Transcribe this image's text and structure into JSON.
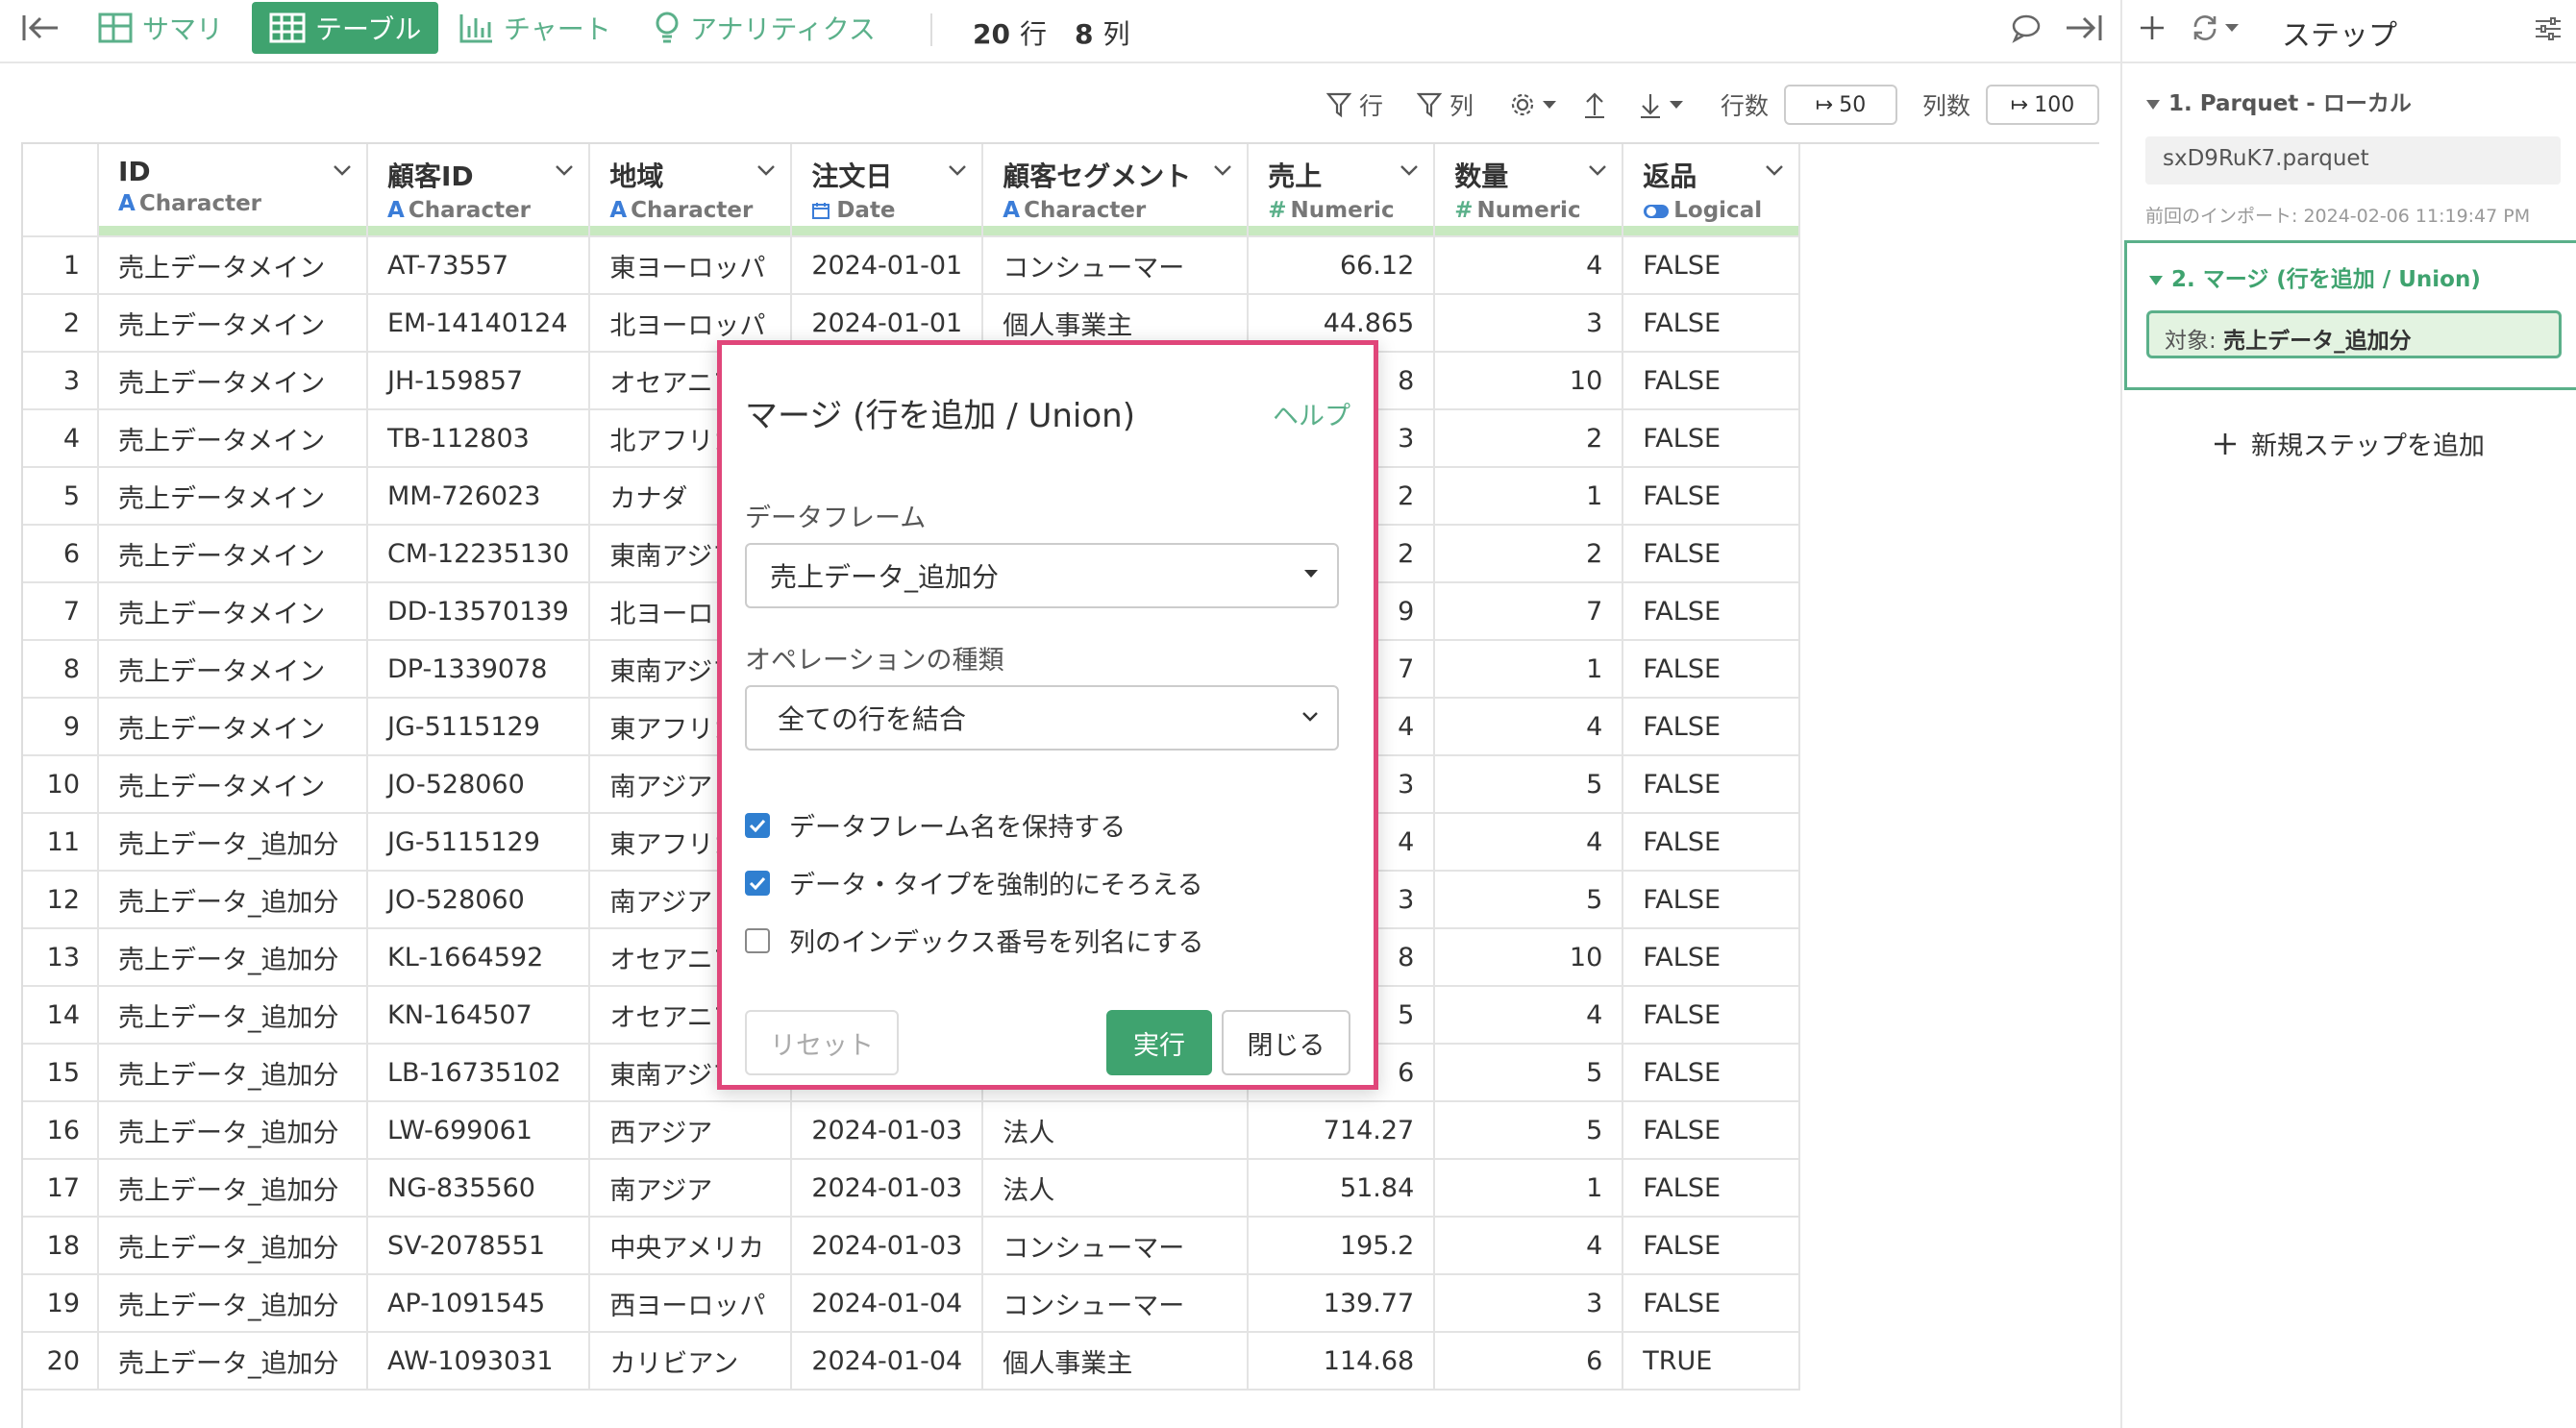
{
  "toolbar": {
    "tabs": [
      {
        "label": "サマリ",
        "icon": "summary-icon"
      },
      {
        "label": "テーブル",
        "icon": "table-icon",
        "active": true
      },
      {
        "label": "チャート",
        "icon": "chart-icon"
      },
      {
        "label": "アナリティクス",
        "icon": "bulb-icon"
      }
    ],
    "row_count": "20",
    "row_unit": "行",
    "col_count": "8",
    "col_unit": "列",
    "accent_color": "#3fa36f"
  },
  "subbar": {
    "filter_row": "行",
    "filter_col": "列",
    "rows_label": "行数",
    "rows_value": "50",
    "cols_label": "列数",
    "cols_value": "100"
  },
  "table": {
    "columns": [
      {
        "name": "ID",
        "type": "Character",
        "type_icon": "A"
      },
      {
        "name": "顧客ID",
        "type": "Character",
        "type_icon": "A"
      },
      {
        "name": "地域",
        "type": "Character",
        "type_icon": "A"
      },
      {
        "name": "注文日",
        "type": "Date",
        "type_icon": "calendar"
      },
      {
        "name": "顧客セグメント",
        "type": "Character",
        "type_icon": "A"
      },
      {
        "name": "売上",
        "type": "Numeric",
        "type_icon": "#"
      },
      {
        "name": "数量",
        "type": "Numeric",
        "type_icon": "#"
      },
      {
        "name": "返品",
        "type": "Logical",
        "type_icon": "toggle"
      }
    ],
    "rows": [
      [
        "1",
        "売上データメイン",
        "AT-73557",
        "東ヨーロッパ",
        "2024-01-01",
        "コンシューマー",
        "66.12",
        "4",
        "FALSE"
      ],
      [
        "2",
        "売上データメイン",
        "EM-14140124",
        "北ヨーロッパ",
        "2024-01-01",
        "個人事業主",
        "44.865",
        "3",
        "FALSE"
      ],
      [
        "3",
        "売上データメイン",
        "JH-159857",
        "オセアニア",
        "",
        "",
        "8",
        "10",
        "FALSE"
      ],
      [
        "4",
        "売上データメイン",
        "TB-112803",
        "北アフリカ",
        "",
        "",
        "3",
        "2",
        "FALSE"
      ],
      [
        "5",
        "売上データメイン",
        "MM-726023",
        "カナダ",
        "",
        "",
        "2",
        "1",
        "FALSE"
      ],
      [
        "6",
        "売上データメイン",
        "CM-12235130",
        "東南アジア",
        "",
        "",
        "2",
        "2",
        "FALSE"
      ],
      [
        "7",
        "売上データメイン",
        "DD-13570139",
        "北ヨーロッパ",
        "",
        "",
        "9",
        "7",
        "FALSE"
      ],
      [
        "8",
        "売上データメイン",
        "DP-1339078",
        "東南アジア",
        "",
        "",
        "7",
        "1",
        "FALSE"
      ],
      [
        "9",
        "売上データメイン",
        "JG-5115129",
        "東アフリカ",
        "",
        "",
        "4",
        "4",
        "FALSE"
      ],
      [
        "10",
        "売上データメイン",
        "JO-528060",
        "南アジア",
        "",
        "",
        "3",
        "5",
        "FALSE"
      ],
      [
        "11",
        "売上データ_追加分",
        "JG-5115129",
        "東アフリカ",
        "",
        "",
        "4",
        "4",
        "FALSE"
      ],
      [
        "12",
        "売上データ_追加分",
        "JO-528060",
        "南アジア",
        "",
        "",
        "3",
        "5",
        "FALSE"
      ],
      [
        "13",
        "売上データ_追加分",
        "KL-1664592",
        "オセアニア",
        "",
        "",
        "8",
        "10",
        "FALSE"
      ],
      [
        "14",
        "売上データ_追加分",
        "KN-164507",
        "オセアニア",
        "",
        "",
        "5",
        "4",
        "FALSE"
      ],
      [
        "15",
        "売上データ_追加分",
        "LB-16735102",
        "東南アジア",
        "",
        "",
        "6",
        "5",
        "FALSE"
      ],
      [
        "16",
        "売上データ_追加分",
        "LW-699061",
        "西アジア",
        "2024-01-03",
        "法人",
        "714.27",
        "5",
        "FALSE"
      ],
      [
        "17",
        "売上データ_追加分",
        "NG-835560",
        "南アジア",
        "2024-01-03",
        "法人",
        "51.84",
        "1",
        "FALSE"
      ],
      [
        "18",
        "売上データ_追加分",
        "SV-2078551",
        "中央アメリカ",
        "2024-01-03",
        "コンシューマー",
        "195.2",
        "4",
        "FALSE"
      ],
      [
        "19",
        "売上データ_追加分",
        "AP-1091545",
        "西ヨーロッパ",
        "2024-01-04",
        "コンシューマー",
        "139.77",
        "3",
        "FALSE"
      ],
      [
        "20",
        "売上データ_追加分",
        "AW-1093031",
        "カリビアン",
        "2024-01-04",
        "個人事業主",
        "114.68",
        "6",
        "TRUE"
      ]
    ]
  },
  "dialog": {
    "title": "マージ (行を追加 / Union)",
    "help": "ヘルプ",
    "dataframe_label": "データフレーム",
    "dataframe_value": "売上データ_追加分",
    "operation_label": "オペレーションの種類",
    "operation_value": "全ての行を結合",
    "checks": [
      {
        "label": "データフレーム名を保持する",
        "checked": true
      },
      {
        "label": "データ・タイプを強制的にそろえる",
        "checked": true
      },
      {
        "label": "列のインデックス番号を列名にする",
        "checked": false
      }
    ],
    "reset": "リセット",
    "run": "実行",
    "close": "閉じる",
    "border_color": "#e0467a"
  },
  "steps_panel": {
    "title": "ステップ",
    "step1_title": "1. Parquet - ローカル",
    "step1_file": "sxD9RuK7.parquet",
    "step1_meta": "前回のインポート: 2024-02-06 11:19:47 PM",
    "step2_title": "2. マージ (行を追加 / Union)",
    "step2_target_label": "対象:",
    "step2_target_value": "売上データ_追加分",
    "add_step": "新規ステップを追加"
  }
}
